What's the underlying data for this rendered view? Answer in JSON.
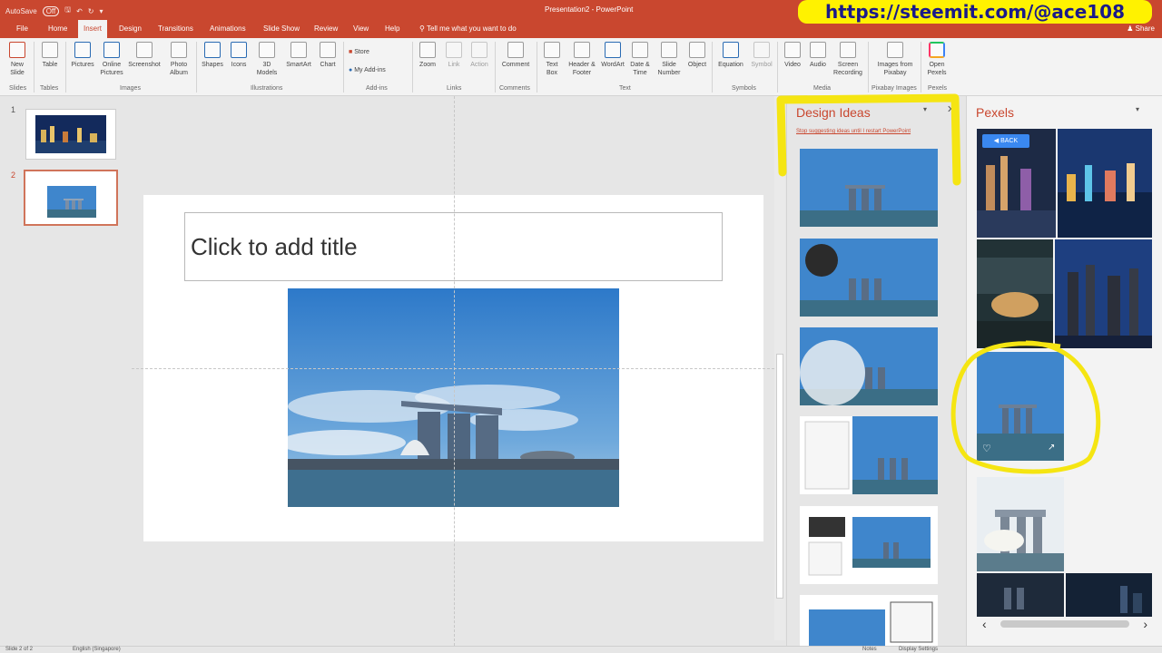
{
  "app": {
    "title": "Presentation2 - PowerPoint",
    "autosave": "AutoSave",
    "autosave_state": "Off"
  },
  "tabs": [
    {
      "label": "File"
    },
    {
      "label": "Home"
    },
    {
      "label": "Insert"
    },
    {
      "label": "Design"
    },
    {
      "label": "Transitions"
    },
    {
      "label": "Animations"
    },
    {
      "label": "Slide Show"
    },
    {
      "label": "Review"
    },
    {
      "label": "View"
    },
    {
      "label": "Help"
    }
  ],
  "tell_me": "Tell me what you want to do",
  "share": "Share",
  "banner": "https://steemit.com/@ace108",
  "ribbon": {
    "buttons": [
      {
        "label": "New Slide"
      },
      {
        "label": "Table"
      },
      {
        "label": "Pictures"
      },
      {
        "label": "Online Pictures"
      },
      {
        "label": "Screenshot"
      },
      {
        "label": "Photo Album"
      },
      {
        "label": "Shapes"
      },
      {
        "label": "Icons"
      },
      {
        "label": "3D Models"
      },
      {
        "label": "SmartArt"
      },
      {
        "label": "Chart"
      },
      {
        "label": "Zoom"
      },
      {
        "label": "Link"
      },
      {
        "label": "Action"
      },
      {
        "label": "Comment"
      },
      {
        "label": "Text Box"
      },
      {
        "label": "Header & Footer"
      },
      {
        "label": "WordArt"
      },
      {
        "label": "Date & Time"
      },
      {
        "label": "Slide Number"
      },
      {
        "label": "Object"
      },
      {
        "label": "Equation"
      },
      {
        "label": "Symbol"
      },
      {
        "label": "Video"
      },
      {
        "label": "Audio"
      },
      {
        "label": "Screen Recording"
      },
      {
        "label": "Images from Pixabay"
      },
      {
        "label": "Open Pexels"
      }
    ],
    "store": "Store",
    "my_addins": "My Add-ins",
    "groups": [
      {
        "label": "Slides"
      },
      {
        "label": "Tables"
      },
      {
        "label": "Images"
      },
      {
        "label": "Illustrations"
      },
      {
        "label": "Add-ins"
      },
      {
        "label": "Links"
      },
      {
        "label": "Comments"
      },
      {
        "label": "Text"
      },
      {
        "label": "Symbols"
      },
      {
        "label": "Media"
      },
      {
        "label": "Pixabay Images"
      },
      {
        "label": "Pexels"
      }
    ]
  },
  "slides": [
    {
      "number": "1"
    },
    {
      "number": "2"
    }
  ],
  "slide": {
    "title_placeholder": "Click to add title"
  },
  "design_ideas": {
    "title": "Design Ideas",
    "stop_link": "Stop suggesting ideas until I restart PowerPoint"
  },
  "pexels": {
    "title": "Pexels",
    "back": "BACK"
  },
  "status": {
    "slide": "Slide 2 of 2",
    "language": "English (Singapore)",
    "notes": "Notes",
    "display": "Display Settings"
  }
}
